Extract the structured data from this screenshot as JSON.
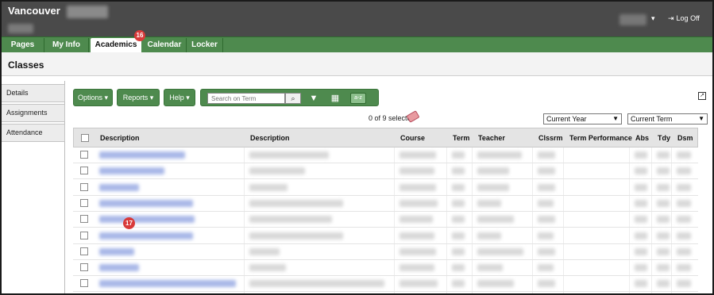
{
  "header": {
    "brand": "Vancouver",
    "logoff_label": "Log Off",
    "logoff_icon": "log-off-icon",
    "user_caret": "▾"
  },
  "nav": {
    "tabs": [
      {
        "label": "Pages"
      },
      {
        "label": "My Info"
      },
      {
        "label": "Academics",
        "active": true
      },
      {
        "label": "Calendar"
      },
      {
        "label": "Locker"
      }
    ],
    "badge": "16"
  },
  "page": {
    "title": "Classes"
  },
  "sidebar": {
    "items": [
      {
        "label": "Details"
      },
      {
        "label": "Assignments"
      },
      {
        "label": "Attendance"
      }
    ]
  },
  "toolbar": {
    "options_label": "Options ▾",
    "reports_label": "Reports ▾",
    "help_label": "Help ▾",
    "search_placeholder": "Search on Term",
    "search_icon": "search-icon",
    "filter_icon": "filter-icon",
    "columns_icon": "columns-icon",
    "sort_label": "a-z"
  },
  "selection": {
    "text": "0 of 9 selected"
  },
  "filters": {
    "year": "Current Year",
    "term": "Current Term"
  },
  "grid": {
    "columns": [
      "Description",
      "Description",
      "Course",
      "Term",
      "Teacher",
      "Clssrm",
      "Term Performance",
      "Abs",
      "Tdy",
      "Dsm"
    ],
    "row_count": 9
  },
  "marker": "17",
  "colors": {
    "header": "#4a4a4a",
    "nav_green": "#4e8a4e",
    "badge_red": "#d83a3a"
  }
}
